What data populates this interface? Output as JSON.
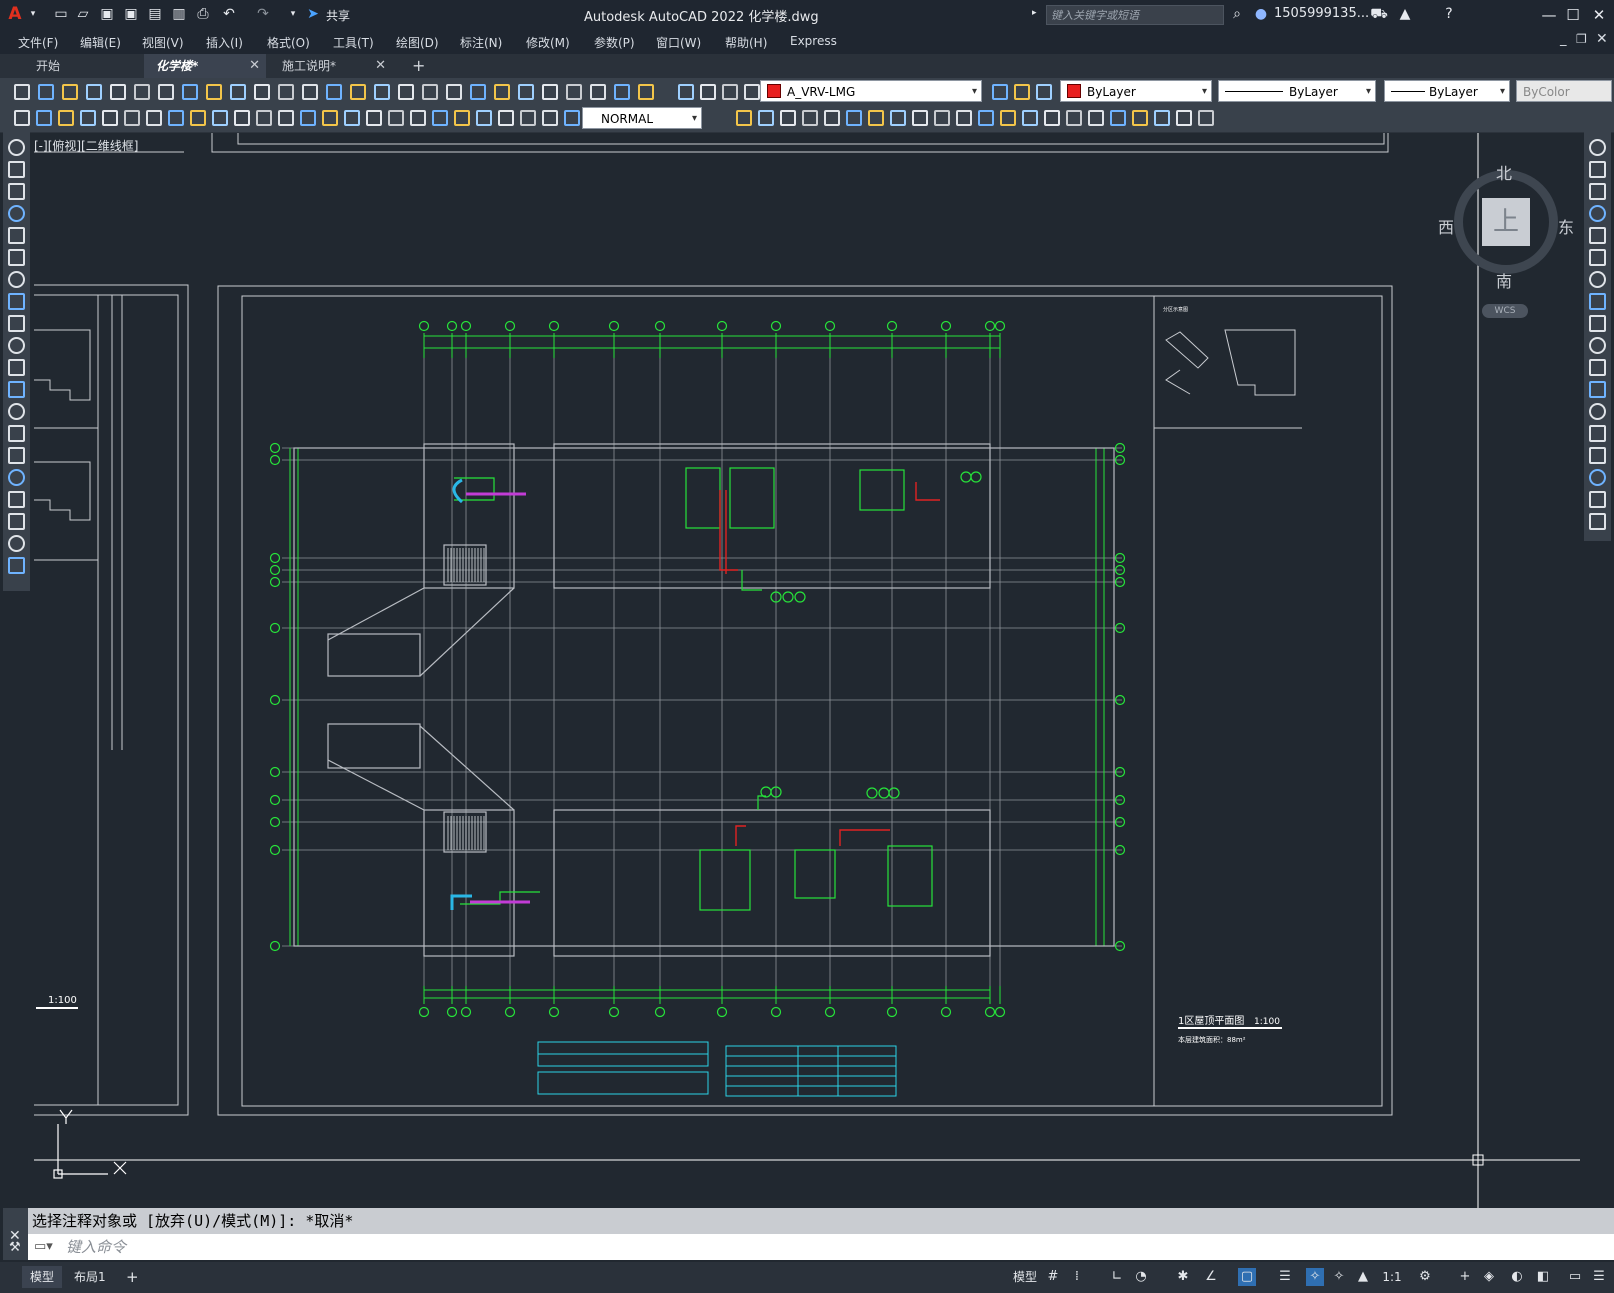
{
  "app": {
    "title": "Autodesk AutoCAD 2022    化学楼.dwg",
    "share_label": "共享",
    "search_placeholder": "键入关键字或短语",
    "user": "1505999135...",
    "logo": "A"
  },
  "menu": [
    "文件(F)",
    "编辑(E)",
    "视图(V)",
    "插入(I)",
    "格式(O)",
    "工具(T)",
    "绘图(D)",
    "标注(N)",
    "修改(M)",
    "参数(P)",
    "窗口(W)",
    "帮助(H)",
    "Express"
  ],
  "tabs": [
    {
      "label": "开始"
    },
    {
      "label": "化学楼*"
    },
    {
      "label": "施工说明*"
    }
  ],
  "properties": {
    "layer": "A_VRV-LMG",
    "color": "ByLayer",
    "linetype": "ByLayer",
    "lineweight": "ByLayer",
    "plotstyle": "ByColor",
    "dimstyle": "NORMAL",
    "layer_color": "#e81f1f"
  },
  "viewport": {
    "label": "[-][俯视][二维线框]"
  },
  "viewcube": {
    "north": "北",
    "south": "南",
    "east": "东",
    "west": "西",
    "top": "上",
    "wcs": "WCS"
  },
  "drawing": {
    "scale_left": "1:100",
    "plan_title": "1区屋顶平面图",
    "plan_scale": "1:100",
    "plan_area": "本层建筑面积：88m²",
    "key_plan_label": "分区示意图",
    "axis_y": "Y",
    "axis_x": "X"
  },
  "command": {
    "history": "选择注释对象或 [放弃(U)/模式(M)]: *取消*",
    "placeholder": "键入命令"
  },
  "status": {
    "layout_tabs": [
      "模型",
      "布局1"
    ],
    "model_label": "模型",
    "annotation_scale": "1:1"
  }
}
